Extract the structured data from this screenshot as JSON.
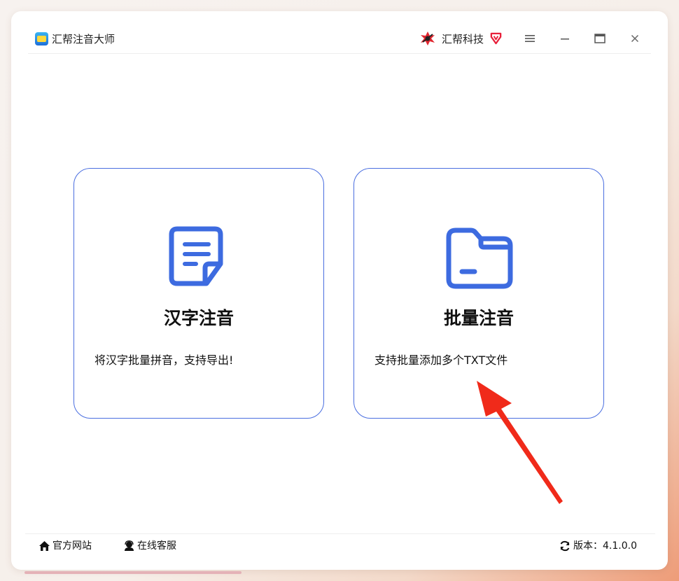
{
  "app": {
    "title": "汇帮注音大师",
    "brand": "汇帮科技"
  },
  "titlebar": {
    "icons": [
      "menu-icon",
      "minimize-icon",
      "maximize-icon",
      "close-icon"
    ]
  },
  "cards": [
    {
      "title": "汉字注音",
      "description": "将汉字批量拼音，支持导出!",
      "icon": "document-icon"
    },
    {
      "title": "批量注音",
      "description": "支持批量添加多个TXT文件",
      "icon": "folder-icon"
    }
  ],
  "footer": {
    "website": "官方网站",
    "service": "在线客服",
    "version": "版本：4.1.0.0"
  },
  "colors": {
    "accent": "#3d6be0",
    "card_border": "#4a6ee0",
    "annotation_arrow": "#f02a1a",
    "vip": "#e8203a"
  }
}
